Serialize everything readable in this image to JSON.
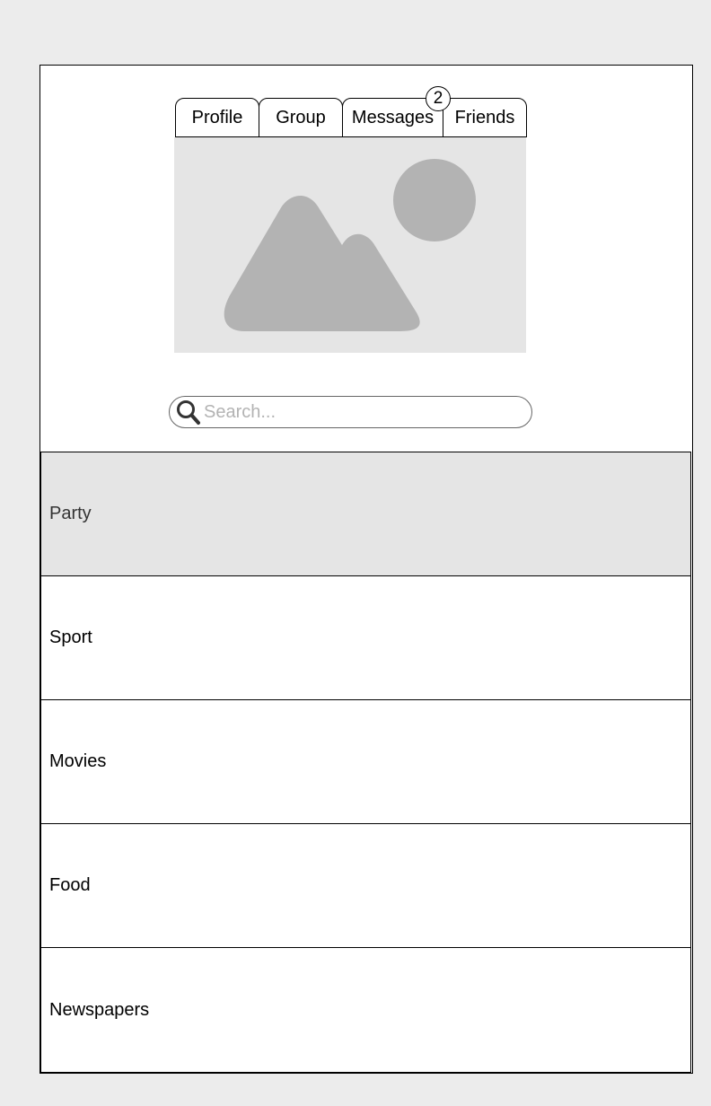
{
  "tabs": [
    {
      "label": "Profile"
    },
    {
      "label": "Group"
    },
    {
      "label": "Messages"
    },
    {
      "label": "Friends"
    }
  ],
  "messages_badge": "2",
  "image_placeholder": {
    "icon": "image-icon",
    "background": "#e5e5e5",
    "shape_color": "#b3b3b3"
  },
  "search": {
    "placeholder": "Search...",
    "value": "",
    "icon": "search-icon"
  },
  "list": {
    "items": [
      {
        "label": "Party",
        "selected": true
      },
      {
        "label": "Sport",
        "selected": false
      },
      {
        "label": "Movies",
        "selected": false
      },
      {
        "label": "Food",
        "selected": false
      },
      {
        "label": "Newspapers",
        "selected": false
      }
    ]
  },
  "colors": {
    "page_background": "#ececec",
    "panel_background": "#ffffff",
    "selected_row": "#e5e5e5",
    "border": "#000000"
  }
}
